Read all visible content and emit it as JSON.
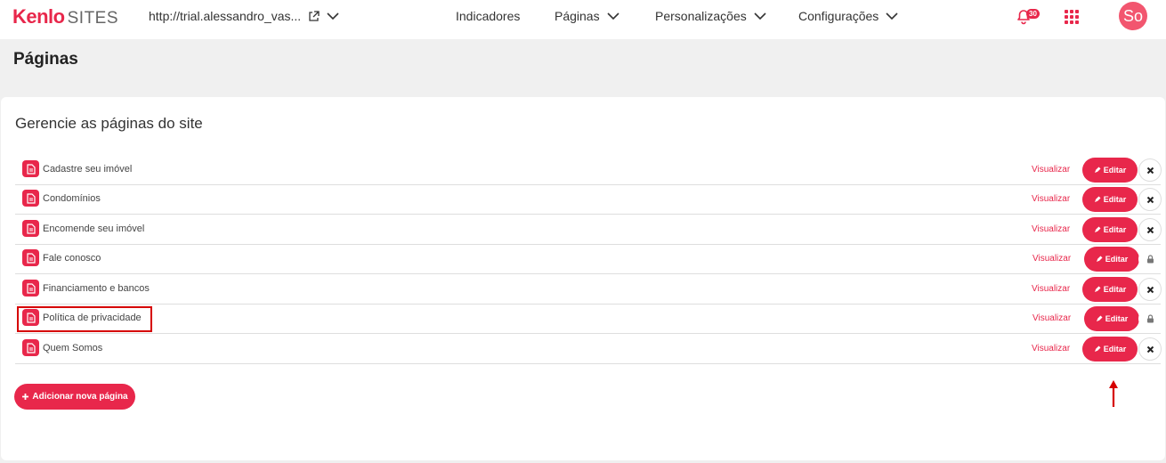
{
  "header": {
    "logo_kenlo": "Kenlo",
    "logo_sites": "SITES",
    "site_url": "http://trial.alessandro_vas...",
    "nav": [
      {
        "label": "Indicadores"
      },
      {
        "label": "Páginas"
      },
      {
        "label": "Personalizações"
      },
      {
        "label": "Configurações"
      }
    ],
    "notifications_count": "30",
    "avatar_initials": "So"
  },
  "page_title": "Páginas",
  "card": {
    "title": "Gerencie as páginas do site",
    "view_label": "Visualizar",
    "edit_label": "Editar",
    "add_label": "Adicionar nova página",
    "rows": [
      {
        "name": "Cadastre seu imóvel",
        "action": "delete"
      },
      {
        "name": "Condomínios",
        "action": "delete"
      },
      {
        "name": "Encomende seu imóvel",
        "action": "delete"
      },
      {
        "name": "Fale conosco",
        "action": "locked"
      },
      {
        "name": "Financiamento e bancos",
        "action": "delete"
      },
      {
        "name": "Política de privacidade",
        "action": "locked"
      },
      {
        "name": "Quem Somos",
        "action": "delete"
      }
    ]
  },
  "colors": {
    "accent": "#e8274b",
    "highlight": "#d60000"
  },
  "icons": {
    "doc": "document-icon",
    "edit": "pencil-icon",
    "delete": "close-icon",
    "locked": "lock-icon",
    "add": "plus-icon"
  }
}
